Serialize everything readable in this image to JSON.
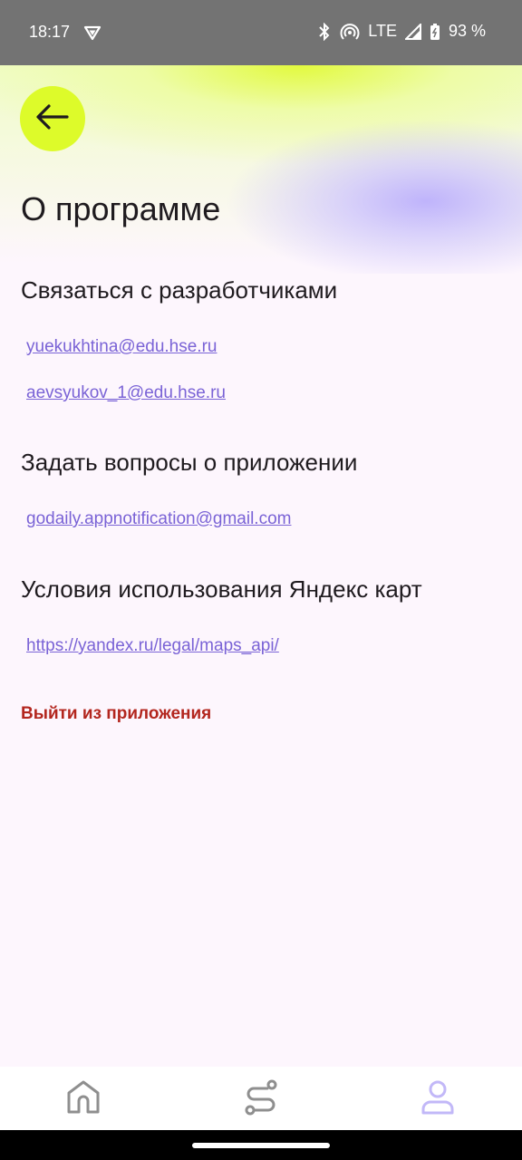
{
  "status_bar": {
    "time": "18:17",
    "network": "LTE",
    "battery": "93 %",
    "icons": [
      "vpn-icon",
      "bluetooth-icon",
      "hotspot-icon",
      "signal-icon",
      "battery-icon"
    ]
  },
  "header": {
    "back_icon": "arrow-left-icon",
    "title": "О программе"
  },
  "sections": [
    {
      "title": "Связаться с разработчиками",
      "links": [
        "yuekukhtina@edu.hse.ru",
        "aevsyukov_1@edu.hse.ru"
      ]
    },
    {
      "title": "Задать вопросы о приложении",
      "links": [
        "godaily.appnotification@gmail.com"
      ]
    },
    {
      "title": "Условия использования Яндекс карт",
      "links": [
        "https://yandex.ru/legal/maps_api/"
      ]
    }
  ],
  "logout_label": "Выйти из приложения",
  "bottom_nav": {
    "items": [
      {
        "icon": "home-icon",
        "active": false
      },
      {
        "icon": "route-icon",
        "active": false
      },
      {
        "icon": "profile-icon",
        "active": true
      }
    ]
  },
  "colors": {
    "accent_lime": "#ddfb2a",
    "accent_lavender": "#bcb0fc",
    "link": "#7a63d6",
    "danger": "#b3261e",
    "background": "#fdf6fd"
  }
}
